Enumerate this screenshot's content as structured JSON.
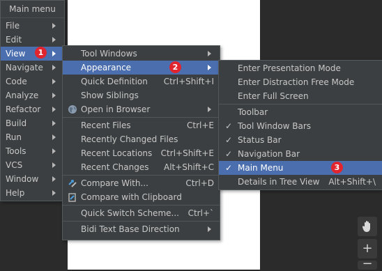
{
  "main_menu": {
    "title": "Main menu",
    "items": [
      {
        "label": "File"
      },
      {
        "label": "Edit"
      },
      {
        "label": "View"
      },
      {
        "label": "Navigate"
      },
      {
        "label": "Code"
      },
      {
        "label": "Analyze"
      },
      {
        "label": "Refactor"
      },
      {
        "label": "Build"
      },
      {
        "label": "Run"
      },
      {
        "label": "Tools"
      },
      {
        "label": "VCS"
      },
      {
        "label": "Window"
      },
      {
        "label": "Help"
      }
    ]
  },
  "view_menu": {
    "items": [
      {
        "label": "Tool Windows"
      },
      {
        "label": "Appearance"
      },
      {
        "label": "Quick Definition",
        "shortcut": "Ctrl+Shift+I"
      },
      {
        "label": "Show Siblings"
      },
      {
        "label": "Open in Browser"
      },
      {
        "label": "Recent Files",
        "shortcut": "Ctrl+E"
      },
      {
        "label": "Recently Changed Files"
      },
      {
        "label": "Recent Locations",
        "shortcut": "Ctrl+Shift+E"
      },
      {
        "label": "Recent Changes",
        "shortcut": "Alt+Shift+C"
      },
      {
        "label": "Compare With...",
        "shortcut": "Ctrl+D"
      },
      {
        "label": "Compare with Clipboard"
      },
      {
        "label": "Quick Switch Scheme...",
        "shortcut": "Ctrl+`"
      },
      {
        "label": "Bidi Text Base Direction"
      }
    ]
  },
  "appearance_menu": {
    "items": [
      {
        "label": "Enter Presentation Mode"
      },
      {
        "label": "Enter Distraction Free Mode"
      },
      {
        "label": "Enter Full Screen"
      },
      {
        "label": "Toolbar"
      },
      {
        "label": "Tool Window Bars"
      },
      {
        "label": "Status Bar"
      },
      {
        "label": "Navigation Bar"
      },
      {
        "label": "Main Menu"
      },
      {
        "label": "Details in Tree View",
        "shortcut": "Alt+Shift+\\"
      }
    ]
  },
  "badges": [
    "1",
    "2",
    "3"
  ],
  "colors": {
    "selection": "#4b6eaf",
    "menu_bg": "#3c3f41",
    "badge": "#e0252f"
  }
}
